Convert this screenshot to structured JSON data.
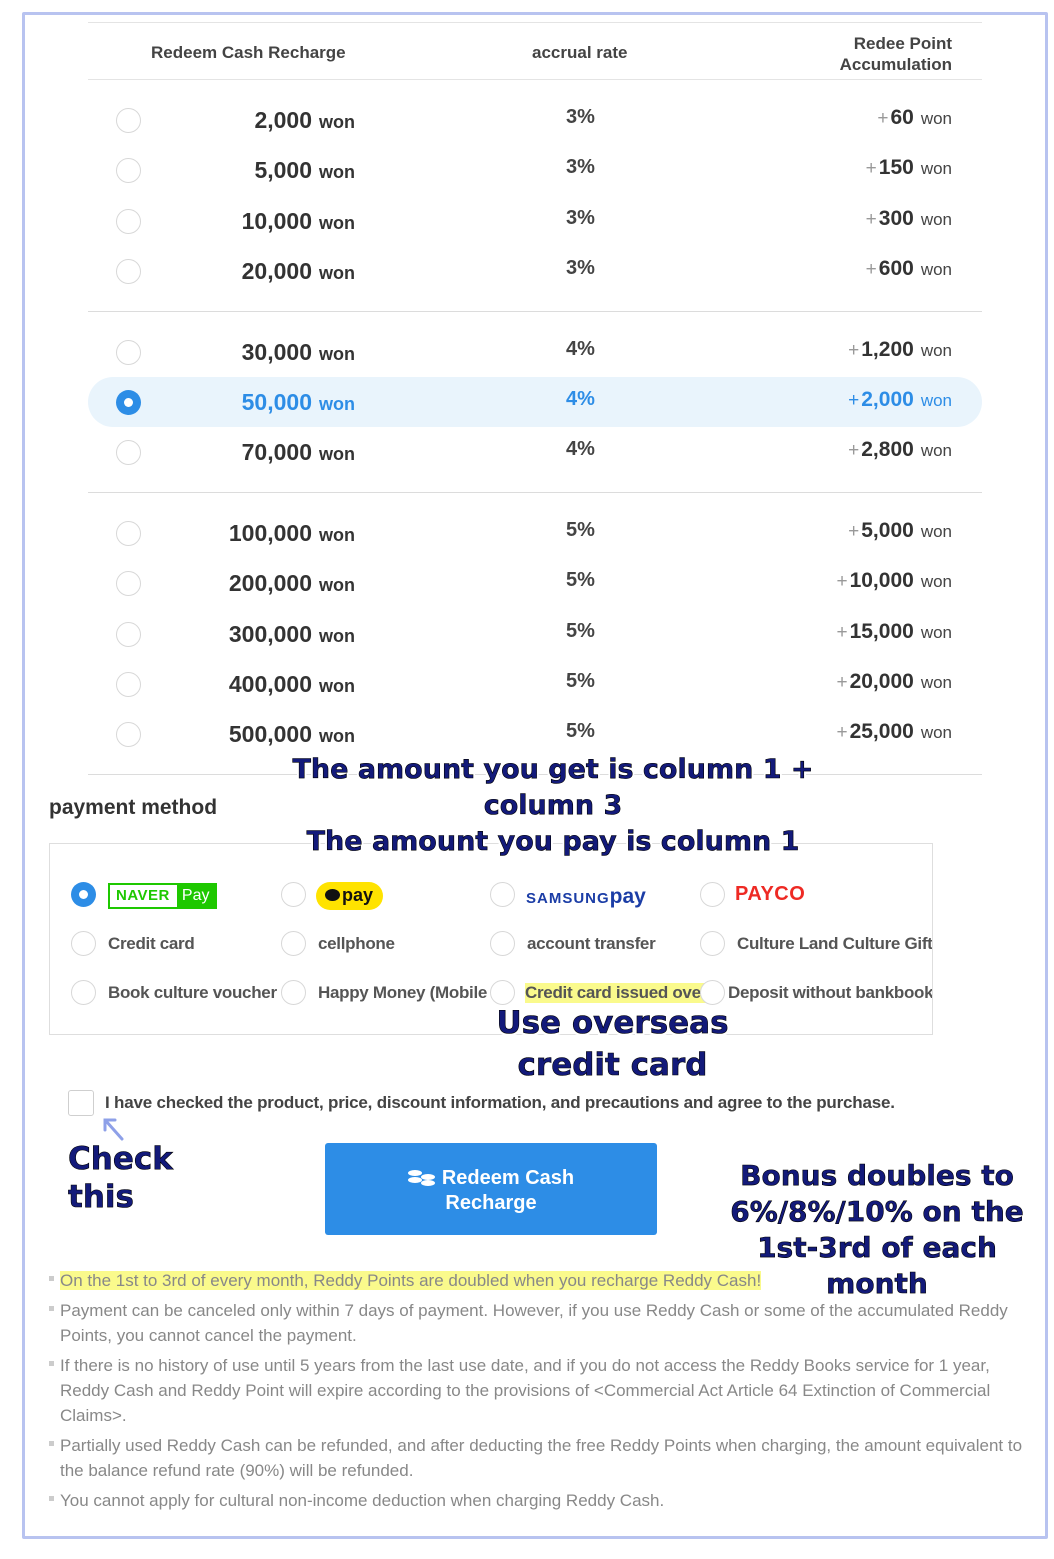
{
  "table": {
    "headers": [
      "Redeem Cash Recharge",
      "accrual rate",
      "Redee Point\nAccumulation"
    ],
    "groups": [
      [
        {
          "amount": "2,000",
          "unit": "won",
          "rate": "3%",
          "plus": "+",
          "points": "60",
          "points_unit": "won",
          "selected": false
        },
        {
          "amount": "5,000",
          "unit": "won",
          "rate": "3%",
          "plus": "+",
          "points": "150",
          "points_unit": "won",
          "selected": false
        },
        {
          "amount": "10,000",
          "unit": "won",
          "rate": "3%",
          "plus": "+",
          "points": "300",
          "points_unit": "won",
          "selected": false
        },
        {
          "amount": "20,000",
          "unit": "won",
          "rate": "3%",
          "plus": "+",
          "points": "600",
          "points_unit": "won",
          "selected": false
        }
      ],
      [
        {
          "amount": "30,000",
          "unit": "won",
          "rate": "4%",
          "plus": "+",
          "points": "1,200",
          "points_unit": "won",
          "selected": false
        },
        {
          "amount": "50,000",
          "unit": "won",
          "rate": "4%",
          "plus": "+",
          "points": "2,000",
          "points_unit": "won",
          "selected": true
        },
        {
          "amount": "70,000",
          "unit": "won",
          "rate": "4%",
          "plus": "+",
          "points": "2,800",
          "points_unit": "won",
          "selected": false
        }
      ],
      [
        {
          "amount": "100,000",
          "unit": "won",
          "rate": "5%",
          "plus": "+",
          "points": "5,000",
          "points_unit": "won",
          "selected": false
        },
        {
          "amount": "200,000",
          "unit": "won",
          "rate": "5%",
          "plus": "+",
          "points": "10,000",
          "points_unit": "won",
          "selected": false
        },
        {
          "amount": "300,000",
          "unit": "won",
          "rate": "5%",
          "plus": "+",
          "points": "15,000",
          "points_unit": "won",
          "selected": false
        },
        {
          "amount": "400,000",
          "unit": "won",
          "rate": "5%",
          "plus": "+",
          "points": "20,000",
          "points_unit": "won",
          "selected": false
        },
        {
          "amount": "500,000",
          "unit": "won",
          "rate": "5%",
          "plus": "+",
          "points": "25,000",
          "points_unit": "won",
          "selected": false
        }
      ]
    ]
  },
  "payment": {
    "title": "payment method",
    "naver": {
      "left": "NAVER",
      "right": "Pay"
    },
    "kakao": {
      "label": "pay"
    },
    "samsung": {
      "brand": "SAMSUNG",
      "pay": "pay"
    },
    "payco": {
      "label": "PAYCO"
    },
    "options": {
      "credit_card": "Credit card",
      "cellphone": "cellphone",
      "account_transfer": "account transfer",
      "culture_land": "Culture Land Culture Gift C",
      "book_voucher": "Book culture voucher",
      "happy_money": "Happy Money (Mobile P",
      "overseas_card": "Credit card issued over",
      "deposit": "Deposit without bankbook"
    }
  },
  "agree": {
    "text": "I have checked the product, price, discount information, and precautions and agree to the purchase."
  },
  "button": {
    "label": "Redeem Cash Recharge"
  },
  "notes": [
    "On the 1st to 3rd of every month, Reddy Points are doubled when you recharge Reddy Cash!",
    "Payment can be canceled only within 7 days of payment. However, if you use Reddy Cash or some of the accumulated Reddy Points, you cannot cancel the payment.",
    "If there is no history of use until 5 years from the last use date, and if you do not access the Reddy Books service for 1 year, Reddy Cash and Reddy Point will expire according to the provisions of <Commercial Act Article 64 Extinction of Commercial Claims>.",
    "Partially used Reddy Cash can be refunded, and after deducting the free Reddy Points when charging, the amount equivalent to the balance refund rate (90%) will be refunded.",
    "You cannot apply for cultural non-income deduction when charging Reddy Cash."
  ],
  "annotations": {
    "table_note_1": "The amount you get is column 1 + column 3",
    "table_note_2": "The amount you pay is column 1",
    "overseas_1": "Use overseas",
    "overseas_2": "credit card",
    "check_this": "Check this",
    "bonus_1": "Bonus doubles to",
    "bonus_2": "6%/8%/10% on the",
    "bonus_3": "1st-3rd of each month"
  },
  "colors": {
    "accent": "#2d8de6",
    "selected_row_bg": "#e9f4fc",
    "naver_green": "#1ec800",
    "kakao_yellow": "#ffe300",
    "payco_red": "#ee2a24",
    "highlight": "#fafa8c",
    "annotation": "#131a7a"
  }
}
